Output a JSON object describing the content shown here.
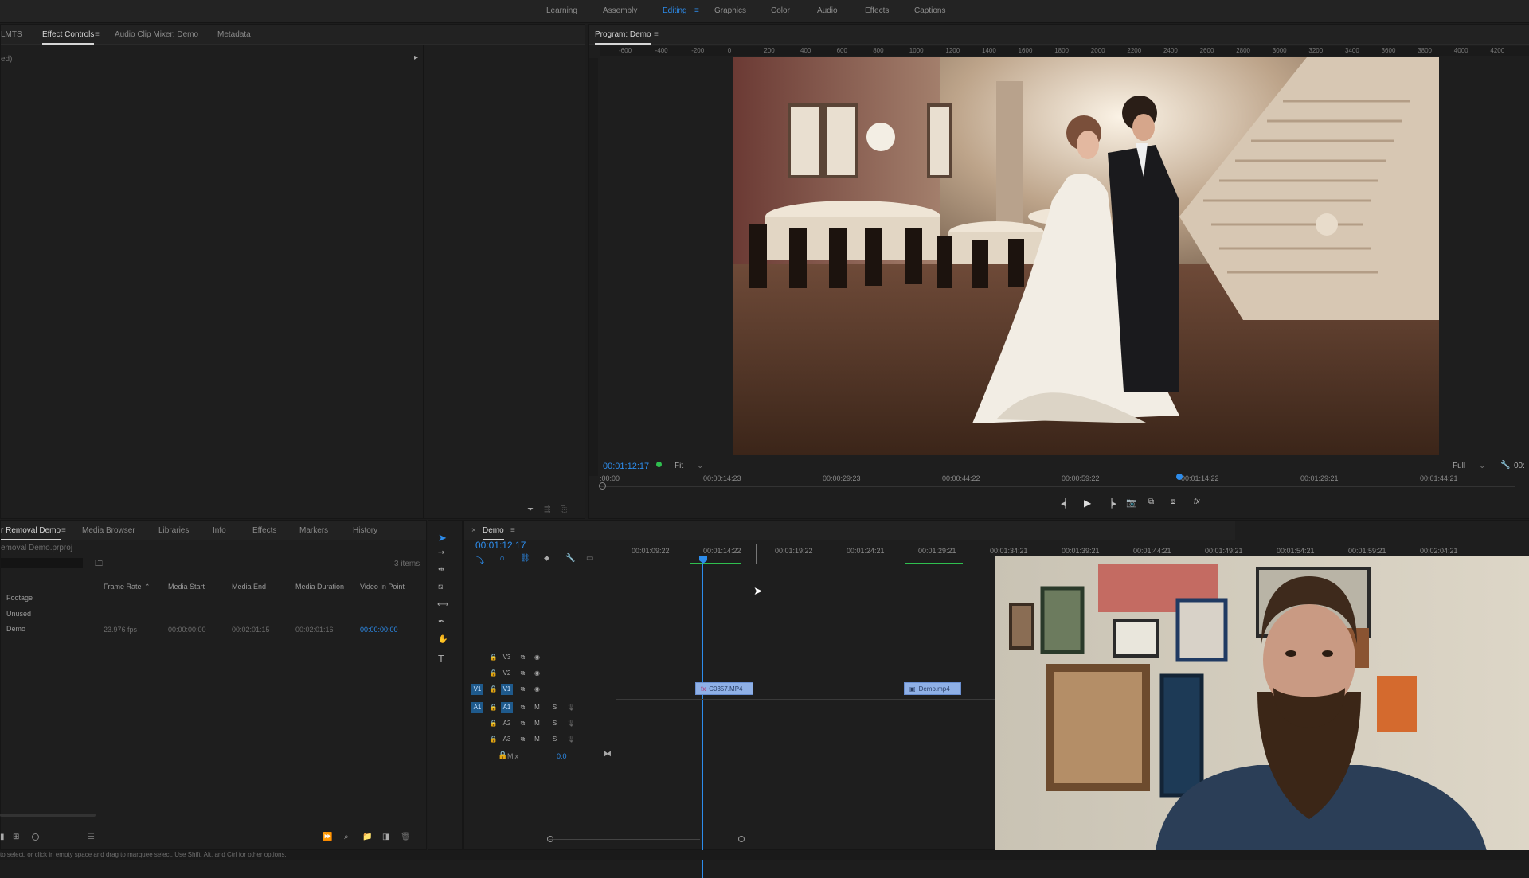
{
  "workspaces": [
    "Learning",
    "Assembly",
    "Editing",
    "Graphics",
    "Color",
    "Audio",
    "Effects",
    "Captions"
  ],
  "active_workspace": "Editing",
  "source_panel": {
    "tabs": [
      "LMTS",
      "Effect Controls",
      "Audio Clip Mixer: Demo",
      "Metadata"
    ],
    "active_tab": "Effect Controls",
    "subtitle": "ed)"
  },
  "program": {
    "title": "Program: Demo",
    "timecode": "00:01:12:17",
    "fit": "Fit",
    "quality": "Full",
    "right_timecode": "00:",
    "ruler_labels": [
      "-600",
      "-400",
      "-200",
      "0",
      "200",
      "400",
      "600",
      "800",
      "1000",
      "1200",
      "1400",
      "1600",
      "1800",
      "2000",
      "2200",
      "2400",
      "2600",
      "2800",
      "3000",
      "3200",
      "3400",
      "3600",
      "3800",
      "4000",
      "4200"
    ],
    "time_labels": [
      ":00:00",
      "00:00:14:23",
      "00:00:29:23",
      "00:00:44:22",
      "00:00:59:22",
      "00:01:14:22",
      "00:01:29:21",
      "00:01:44:21"
    ]
  },
  "project_panel": {
    "tabs": [
      "r Removal Demo",
      "Media Browser",
      "Libraries",
      "Info",
      "Effects",
      "Markers",
      "History"
    ],
    "active_tab": "r Removal Demo",
    "project_file": "emoval Demo.prproj",
    "item_count": "3 items",
    "columns": [
      "Frame Rate",
      "Media Start",
      "Media End",
      "Media Duration",
      "Video In Point"
    ],
    "rows": [
      {
        "name": "Footage",
        "frame_rate": "",
        "start": "",
        "end": "",
        "duration": "",
        "in_point": ""
      },
      {
        "name": "Unused",
        "frame_rate": "",
        "start": "",
        "end": "",
        "duration": "",
        "in_point": ""
      },
      {
        "name": "Demo",
        "frame_rate": "23.976 fps",
        "start": "00:00:00:00",
        "end": "00:02:01:15",
        "duration": "00:02:01:16",
        "in_point": "00:00:00:00"
      }
    ]
  },
  "timeline": {
    "sequence_name": "Demo",
    "timecode": "00:01:12:17",
    "time_labels": [
      "00:01:09:22",
      "00:01:14:22",
      "00:01:19:22",
      "00:01:24:21",
      "00:01:29:21",
      "00:01:34:21",
      "00:01:39:21",
      "00:01:44:21",
      "00:01:49:21",
      "00:01:54:21",
      "00:01:59:21",
      "00:02:04:21"
    ],
    "tracks": [
      {
        "target": "",
        "name": "V3",
        "kind": "video"
      },
      {
        "target": "",
        "name": "V2",
        "kind": "video"
      },
      {
        "target": "V1",
        "name": "V1",
        "kind": "video"
      },
      {
        "target": "A1",
        "name": "A1",
        "kind": "audio"
      },
      {
        "target": "",
        "name": "A2",
        "kind": "audio"
      },
      {
        "target": "",
        "name": "A3",
        "kind": "audio"
      }
    ],
    "mix_label": "Mix",
    "mix_value": "0.0",
    "clips": [
      "C0357.MP4",
      "Demo.mp4"
    ]
  },
  "status_bar": "to select, or click in empty space and drag to marquee select. Use Shift, Alt, and Ctrl for other options.",
  "colors": {
    "accent": "#2d8ceb",
    "clip": "#8fb0e6",
    "playhead": "#2d8ceb",
    "green": "#2fbf4f"
  },
  "icons": [
    "selection-tool-icon",
    "track-select-icon",
    "ripple-edit-icon",
    "razor-icon",
    "slip-icon",
    "pen-icon",
    "hand-icon",
    "type-icon",
    "play-icon",
    "step-back-icon",
    "step-forward-icon",
    "camera-icon",
    "wrench-icon",
    "lock-icon",
    "eye-icon",
    "filter-icon",
    "search-icon",
    "folder-icon"
  ]
}
